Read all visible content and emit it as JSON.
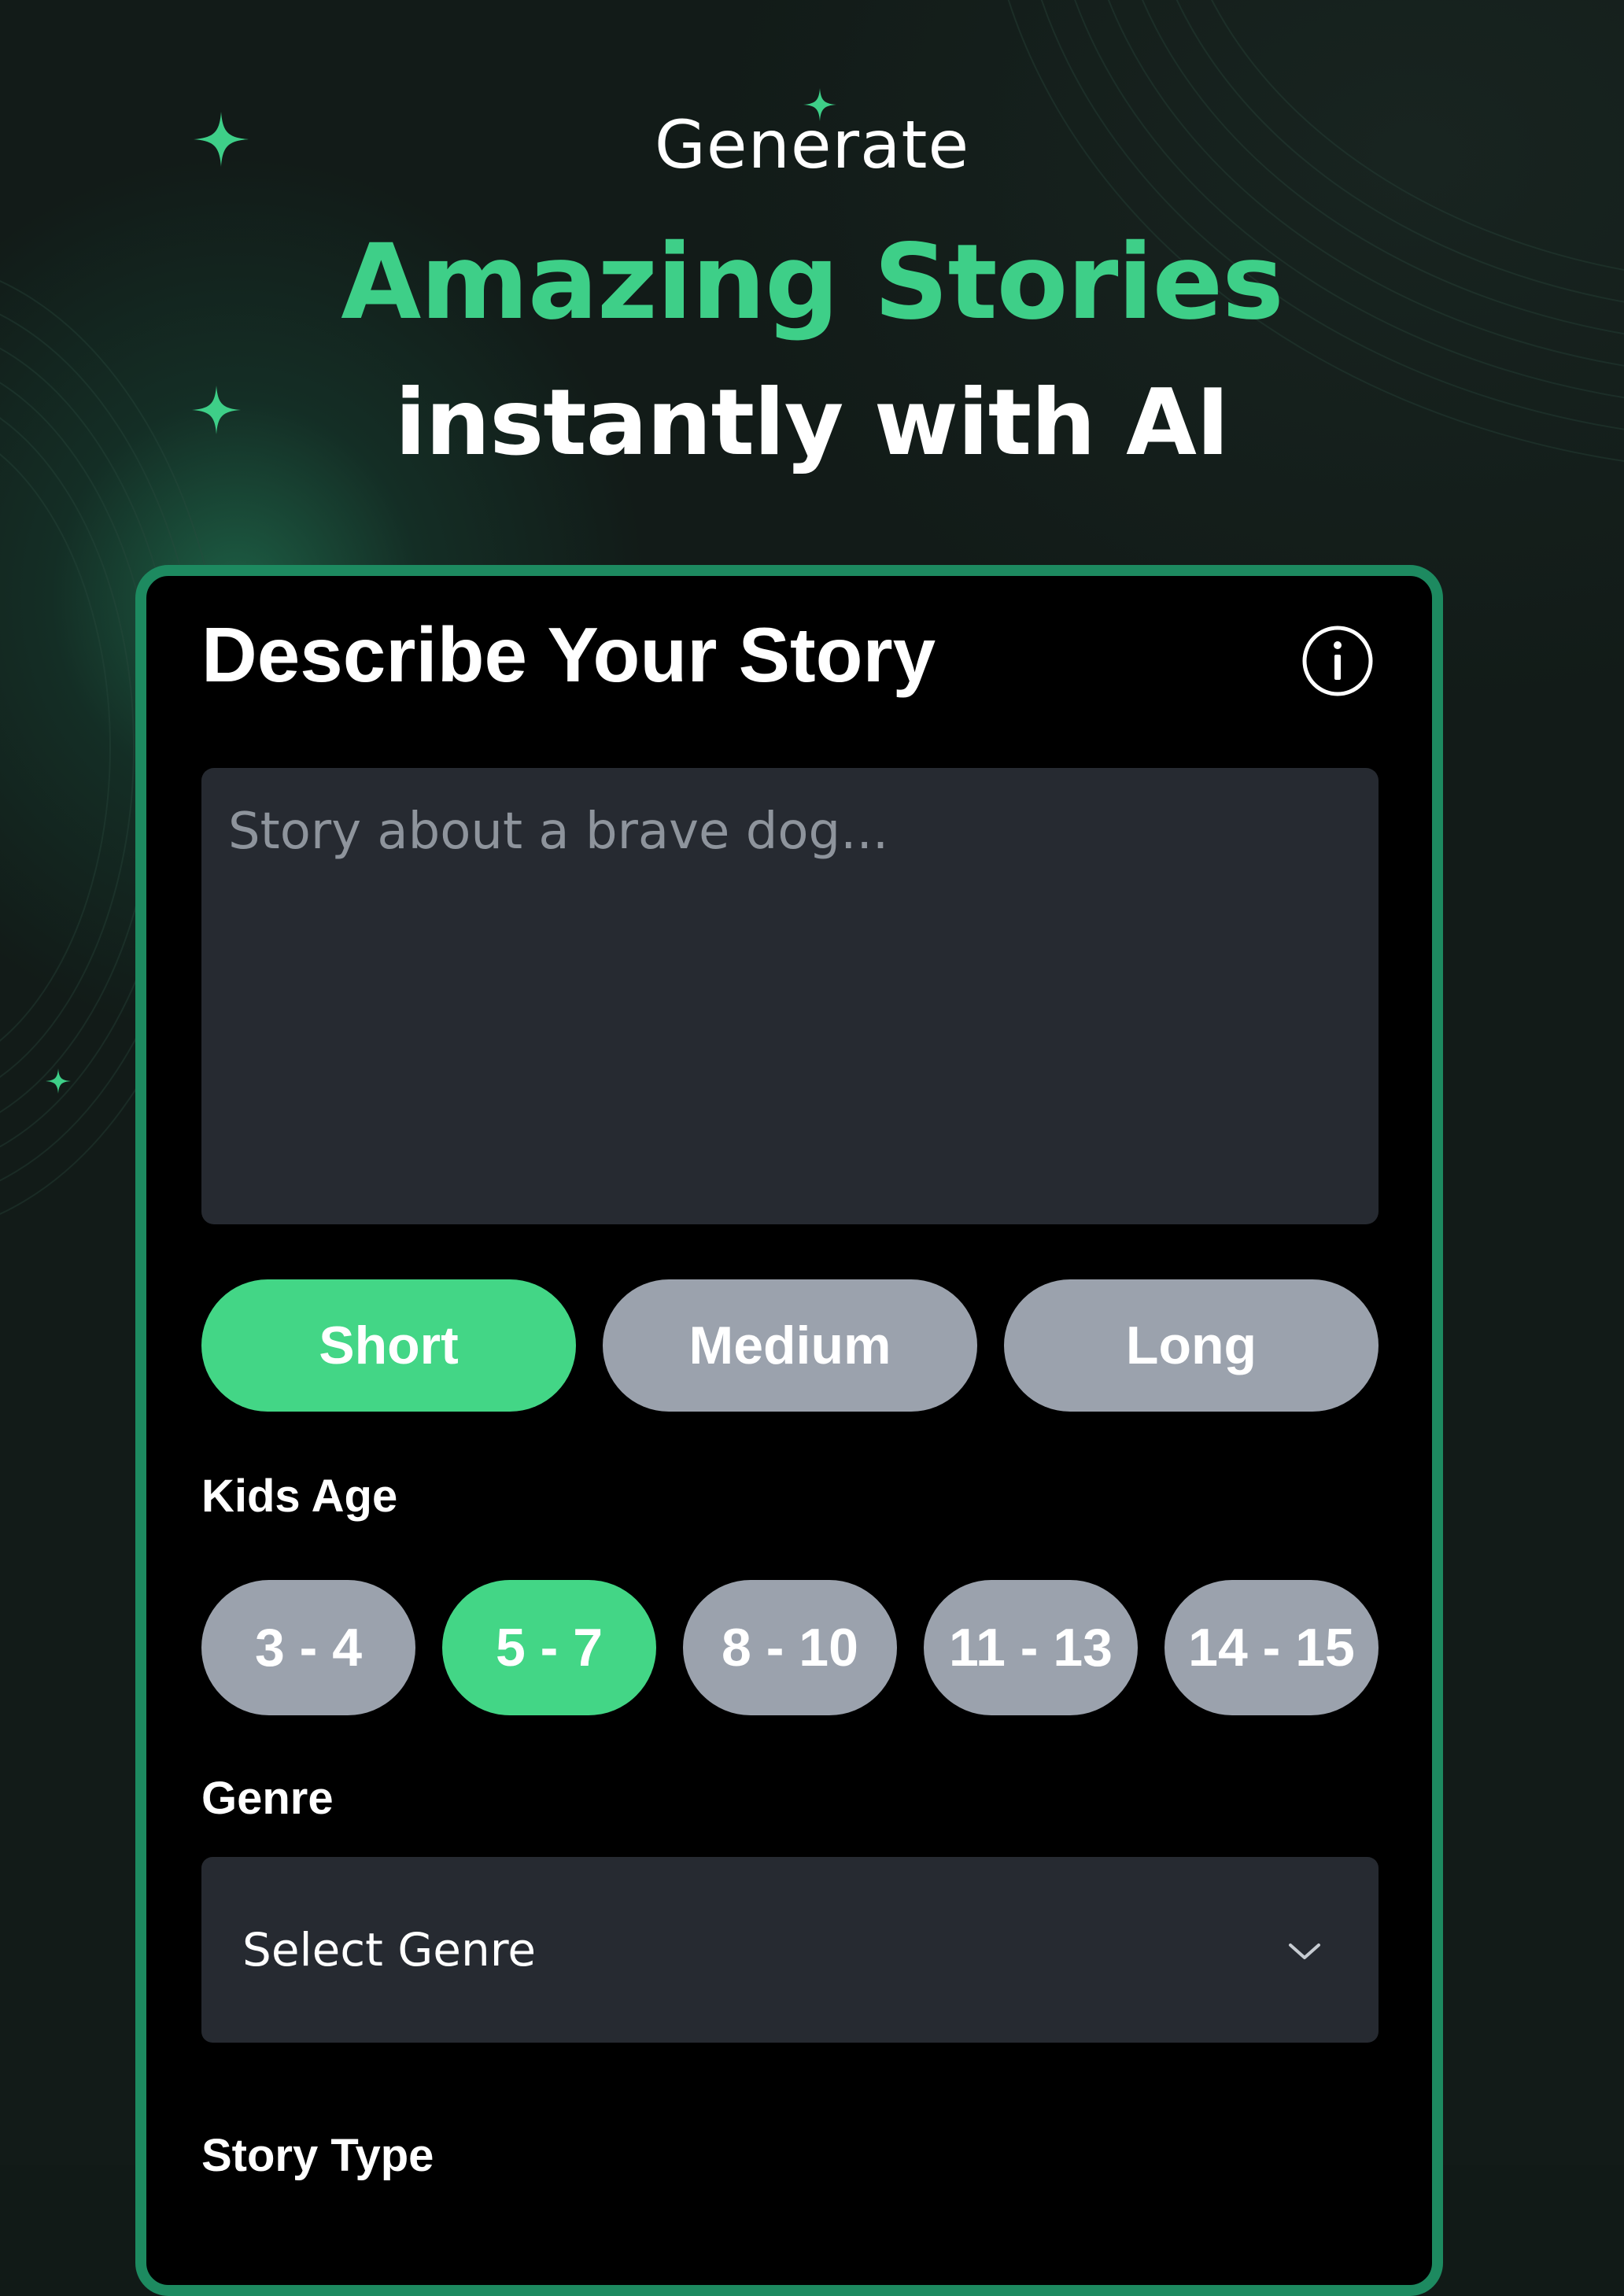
{
  "hero": {
    "pre_title": "Generate",
    "title": "Amazing Stories",
    "subtitle": "instantly with AI"
  },
  "card": {
    "title": "Describe Your Story",
    "info_icon": "info-icon",
    "prompt_placeholder": "Story about a brave dog...",
    "length_options": [
      {
        "label": "Short",
        "selected": true
      },
      {
        "label": "Medium",
        "selected": false
      },
      {
        "label": "Long",
        "selected": false
      }
    ],
    "age_label": "Kids Age",
    "age_options": [
      {
        "label": "3 - 4",
        "selected": false
      },
      {
        "label": "5 - 7",
        "selected": true
      },
      {
        "label": "8 - 10",
        "selected": false
      },
      {
        "label": "11 - 13",
        "selected": false
      },
      {
        "label": "14 - 15",
        "selected": false
      }
    ],
    "genre_label": "Genre",
    "genre_select": {
      "value": "Select Genre",
      "icon": "chevron-down-icon"
    },
    "story_type_label": "Story Type"
  },
  "colors": {
    "accent": "#3ecf88",
    "pill_active": "#43d686",
    "pill_inactive": "#9ba2ad",
    "card_border": "#1d8a60",
    "card_bg": "#000000",
    "field_bg": "#262a31",
    "page_bg": "#121b18"
  }
}
